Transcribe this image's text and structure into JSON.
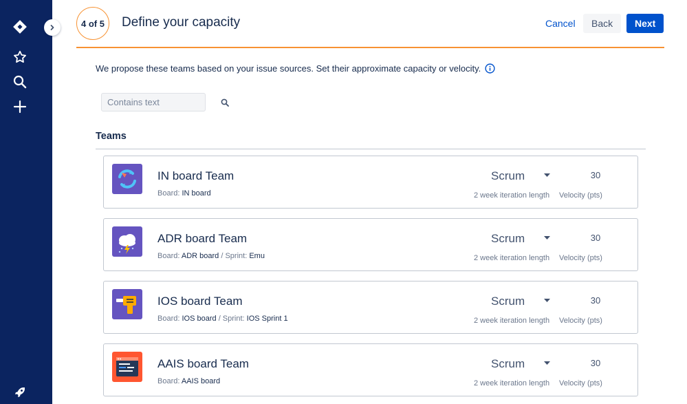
{
  "nav": {
    "bg_color": "#0b2460",
    "icons": [
      "jira-logo-icon",
      "star-icon",
      "search-icon",
      "plus-icon",
      "rocket-icon"
    ]
  },
  "header": {
    "step": "4 of 5",
    "title": "Define your capacity",
    "cancel_label": "Cancel",
    "back_label": "Back",
    "next_label": "Next",
    "accent_color": "#f79232",
    "primary_color": "#0052cc"
  },
  "intro": {
    "text": "We propose these teams based on your issue sources. Set their approximate capacity or velocity."
  },
  "search": {
    "placeholder": "Contains text"
  },
  "teams_heading": "Teams",
  "teams": [
    {
      "name": "IN board Team",
      "board_label": "Board:",
      "board": "IN board",
      "sprint_label": "",
      "sprint": "",
      "method": "Scrum",
      "velocity": "30",
      "iteration_text": "2 week iteration length",
      "velocity_text": "Velocity (pts)",
      "avatar": "sync-arrows-icon"
    },
    {
      "name": "ADR board Team",
      "board_label": "Board:",
      "board": "ADR board",
      "sprint_label": "/ Sprint:",
      "sprint": "Emu",
      "method": "Scrum",
      "velocity": "30",
      "iteration_text": "2 week iteration length",
      "velocity_text": "Velocity (pts)",
      "avatar": "storm-cloud-icon"
    },
    {
      "name": "IOS board Team",
      "board_label": "Board:",
      "board": "IOS board",
      "sprint_label": "/ Sprint:",
      "sprint": "IOS Sprint 1",
      "method": "Scrum",
      "velocity": "30",
      "iteration_text": "2 week iteration length",
      "velocity_text": "Velocity (pts)",
      "avatar": "drill-icon"
    },
    {
      "name": "AAIS board Team",
      "board_label": "Board:",
      "board": "AAIS board",
      "sprint_label": "",
      "sprint": "",
      "method": "Scrum",
      "velocity": "30",
      "iteration_text": "2 week iteration length",
      "velocity_text": "Velocity (pts)",
      "avatar": "code-window-icon"
    }
  ]
}
